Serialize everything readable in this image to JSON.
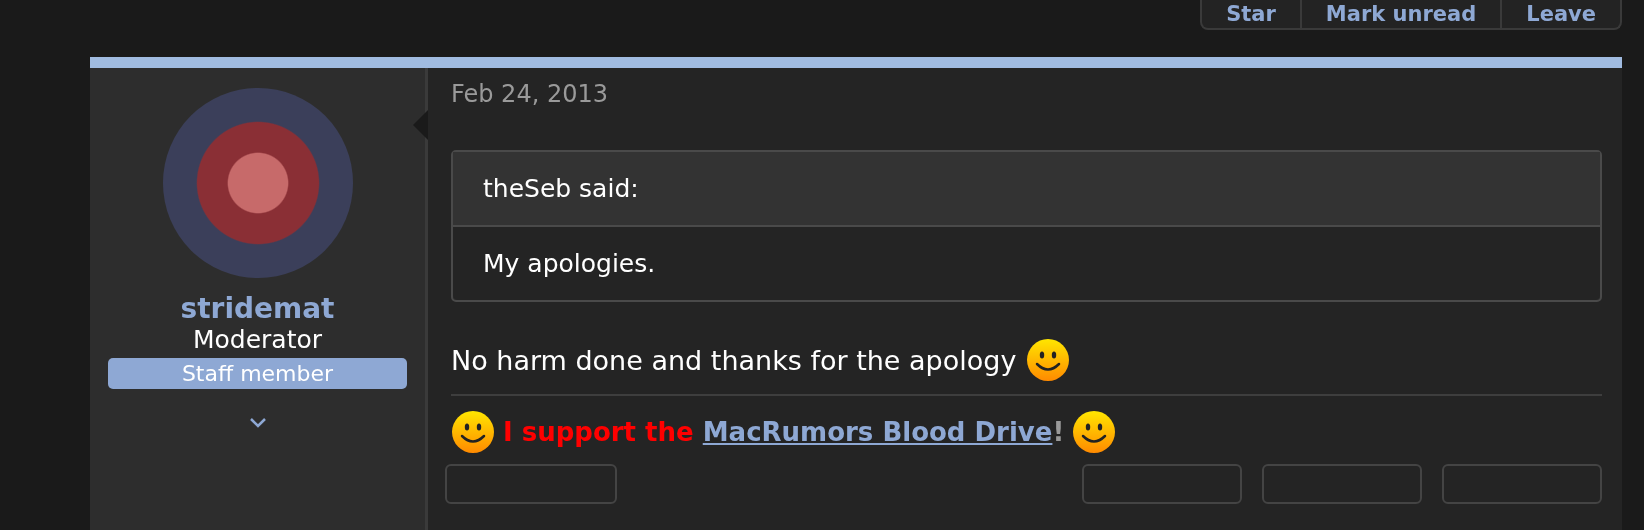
{
  "thread_actions": [
    {
      "label": "Star"
    },
    {
      "label": "Mark unread"
    },
    {
      "label": "Leave"
    }
  ],
  "post": {
    "author": {
      "name": "stridemat",
      "title": "Moderator",
      "badge": "Staff member"
    },
    "date": "Feb 24, 2013",
    "quote": {
      "attribution": "theSeb said:",
      "text": "My apologies."
    },
    "message": "No harm done and thanks for the apology",
    "signature": {
      "prefix": "I support the ",
      "link": "MacRumors Blood Drive",
      "suffix": "!"
    },
    "footer_actions": [
      {
        "kind": "left"
      },
      {
        "kind": "right"
      },
      {
        "kind": "right"
      },
      {
        "kind": "right"
      }
    ]
  }
}
